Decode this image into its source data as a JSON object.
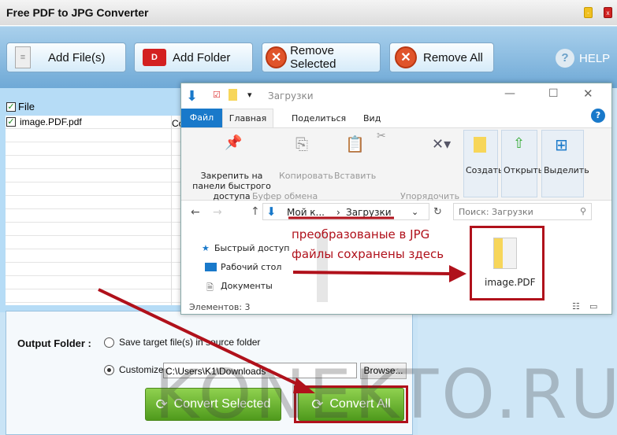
{
  "app": {
    "title": "Free PDF to JPG Converter"
  },
  "toolbar": {
    "add_files": "Add File(s)",
    "add_folder": "Add Folder",
    "remove_selected": "Remove Selected",
    "remove_all": "Remove All",
    "help": "HELP"
  },
  "list": {
    "header": "File",
    "second_col": "Co",
    "rows": [
      {
        "name": "image.PDF.pdf",
        "checked": true
      }
    ]
  },
  "output": {
    "label": "Output Folder :",
    "option_source": "Save target file(s) in source folder",
    "option_custom": "Customize :",
    "path": "C:\\Users\\K1\\Downloads",
    "browse": "Browse...",
    "selected": "custom"
  },
  "actions": {
    "convert_selected": "Convert Selected",
    "convert_all": "Convert All"
  },
  "explorer": {
    "title": "Загрузки",
    "tabs": [
      "Файл",
      "Главная",
      "Поделиться",
      "Вид"
    ],
    "ribbon": {
      "pin": "Закрепить на панели быстрого доступа",
      "copy": "Копировать",
      "paste": "Вставить",
      "clipboard_group": "Буфер обмена",
      "organize_group": "Упорядочить",
      "create": "Создать",
      "open": "Открыть",
      "select": "Выделить"
    },
    "breadcrumb": [
      "Мой к...",
      "Загрузки"
    ],
    "search_placeholder": "Поиск: Загрузки",
    "nav": [
      "Быстрый доступ",
      "Рабочий стол",
      "Документы"
    ],
    "file": "image.PDF",
    "status": "Элементов: 3"
  },
  "annotation": {
    "line1": "преобразованые в JPG",
    "line2": "файлы сохранены здесь",
    "color": "#b0111b"
  },
  "watermark": "KONEKTO.RU"
}
